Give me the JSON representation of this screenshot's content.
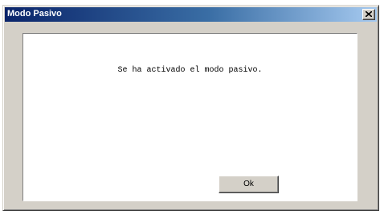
{
  "window": {
    "title": "Modo Pasivo",
    "close_symbol": "×"
  },
  "dialog": {
    "message": "Se ha activado el modo pasivo.",
    "ok_label": "Ok"
  },
  "colors": {
    "titlebar_start": "#0a246a",
    "titlebar_end": "#a6caf0",
    "window_face": "#d4d0c8",
    "panel_background": "#ffffff"
  },
  "icons": {
    "close": "close-icon"
  }
}
